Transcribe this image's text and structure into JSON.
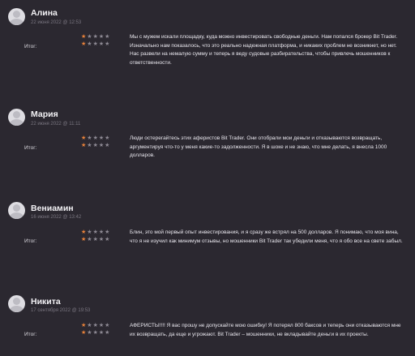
{
  "reviews": [
    {
      "name": "Алина",
      "date": "22 июня 2022 @ 12:53",
      "label": "Итог:",
      "rating_rows": [
        1,
        1
      ],
      "text": "Мы с мужем искали площадку, куда можно инвестировать свободные деньги. Нам попался брокер Bit Trader. Изначально нам показалось, что это реально надежная платформа, и никаких проблем не возникнет, но нет. Нас развели на немалую сумму и теперь я веду судовые разбирательства, чтобы привлечь мошенников к ответственности."
    },
    {
      "name": "Мария",
      "date": "22 июня 2022 @ 11:11",
      "label": "Итог:",
      "rating_rows": [
        1,
        1
      ],
      "text": "Люди остерегайтесь этих аферистов Bit Trader. Они отобрали мои деньги и отказываются возвращать, аргументируя что-то у меня какие-то задолженности. Я в шоке и не знаю, что мне делать, я внесла 1000 долларов."
    },
    {
      "name": "Вениамин",
      "date": "16 июня 2022 @ 13:42",
      "label": "Итог:",
      "rating_rows": [
        1,
        1
      ],
      "text": "Блин, это мой первый опыт инвестирования, и я сразу же встрял на 500 долларов. Я понимаю, что моя вина, что я не изучил как минимум отзывы, но мошенники Bit Trader так убедили меня, что я обо все на свете забыл."
    },
    {
      "name": "Никита",
      "date": "17 сентября 2022 @ 19:53",
      "label": "Итог:",
      "rating_rows": [
        1,
        1
      ],
      "text": "АФЕРИСТЫ!!!! Я вас прошу не допускайте мою ошибку! Я потерял 800 баксов и теперь они отказываются мне их возвращать, да еще и угрожают. Bit Trader – мошенники, не вкладывайте деньги в их проекты."
    }
  ],
  "colors": {
    "background": "#2b2830",
    "star_on": "#e8823a",
    "star_off": "#8e8a94"
  },
  "icons": {
    "avatar": "user-avatar-icon",
    "star": "star-icon"
  }
}
